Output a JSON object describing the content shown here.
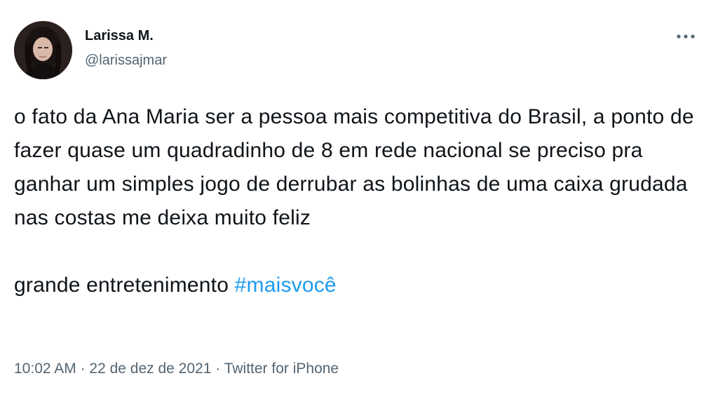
{
  "author": {
    "display_name": "Larissa M.",
    "handle": "@larissajmar"
  },
  "more_icon": "more-horizontal-icon",
  "tweet": {
    "paragraph_1": "o fato da Ana Maria ser a pessoa mais competitiva do Brasil, a ponto de fazer quase um quadradinho de 8 em rede nacional se preciso pra ganhar um simples jogo de derrubar as bolinhas de uma caixa grudada nas costas me deixa muito feliz",
    "paragraph_2_text": "grande entretenimento ",
    "hashtag": "#maisvocê"
  },
  "meta": {
    "time": "10:02 AM",
    "separator_1": " · ",
    "date": "22 de dez de 2021",
    "separator_2": " · ",
    "source": "Twitter for iPhone"
  },
  "colors": {
    "text": "#0f1419",
    "secondary": "#536471",
    "hashtag": "#1d9bf0"
  }
}
